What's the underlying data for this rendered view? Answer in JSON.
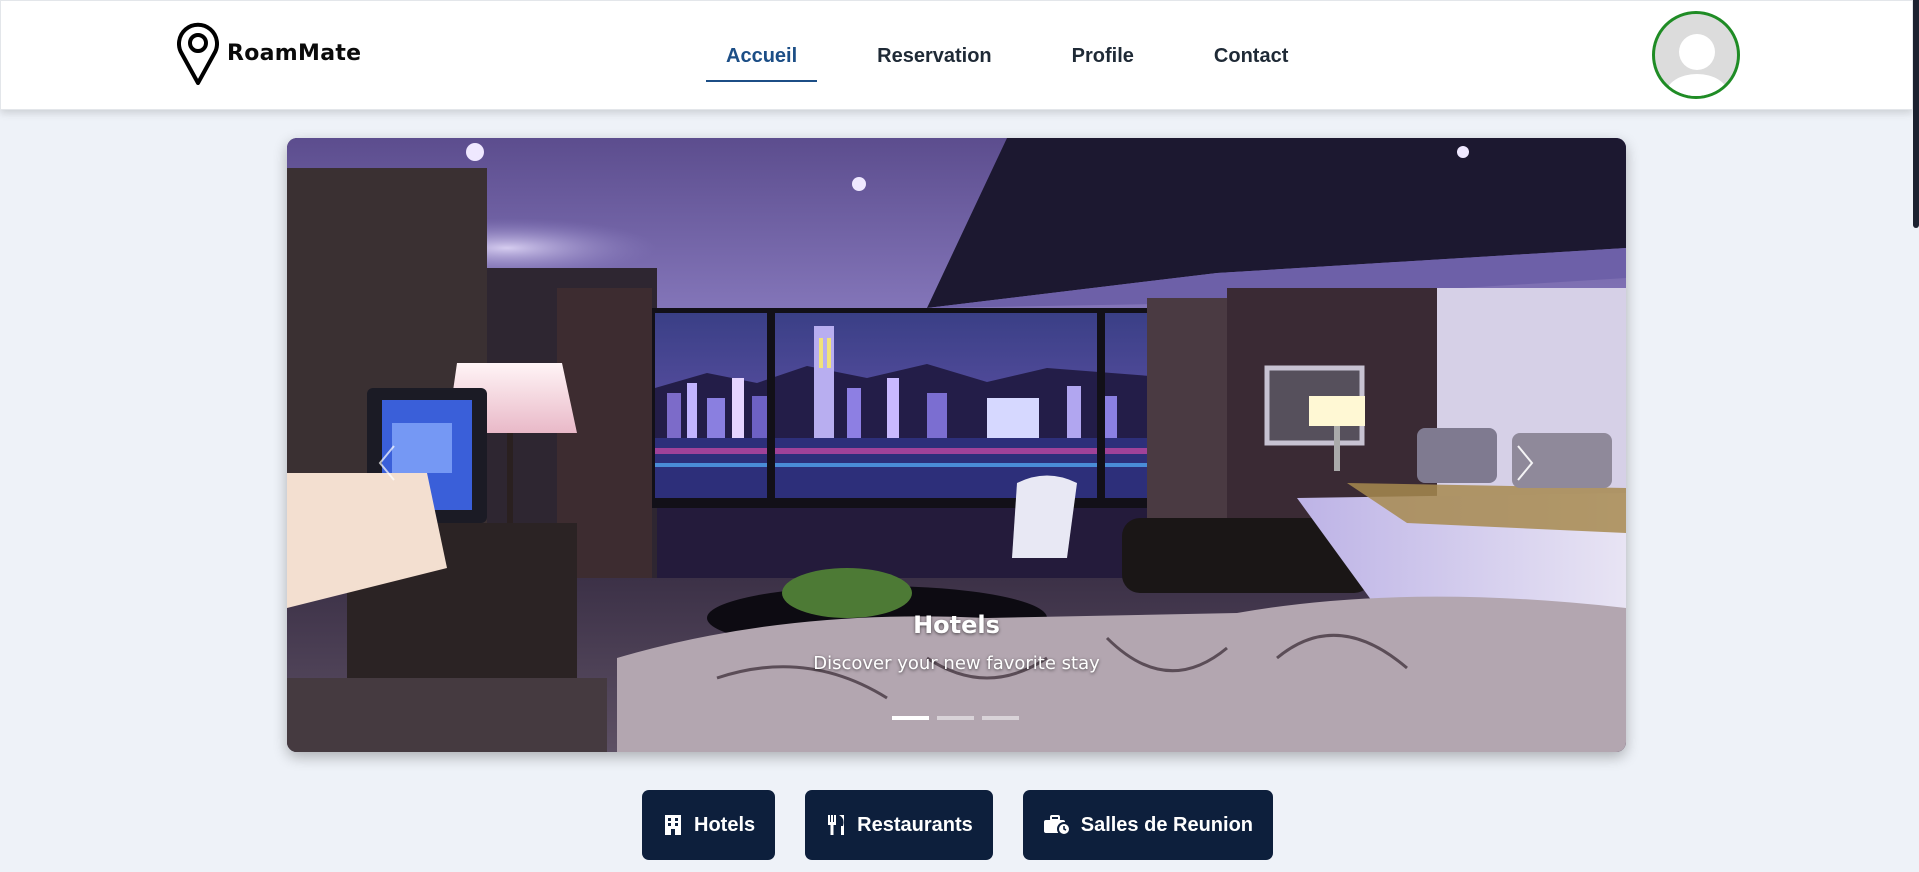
{
  "brand": {
    "name": "RoamMate",
    "logo_icon": "map-pin-icon"
  },
  "nav": {
    "items": [
      {
        "label": "Accueil",
        "active": true
      },
      {
        "label": "Reservation",
        "active": false
      },
      {
        "label": "Profile",
        "active": false
      },
      {
        "label": "Contact",
        "active": false
      }
    ]
  },
  "user": {
    "avatar_icon": "user-avatar-icon"
  },
  "carousel": {
    "slide": {
      "title": "Hotels",
      "subtitle": "Discover your new favorite stay"
    },
    "prev_icon": "chevron-left-icon",
    "next_icon": "chevron-right-icon",
    "slide_count": 3,
    "active_slide": 1
  },
  "categories": [
    {
      "label": "Hotels",
      "icon": "hotel-icon"
    },
    {
      "label": "Restaurants",
      "icon": "utensils-icon"
    },
    {
      "label": "Salles de Reunion",
      "icon": "briefcase-clock-icon"
    }
  ],
  "colors": {
    "page_bg": "#eef2f8",
    "nav_active": "#1c4e86",
    "avatar_border": "#1f8c25",
    "button_bg": "#0d1f3c"
  }
}
